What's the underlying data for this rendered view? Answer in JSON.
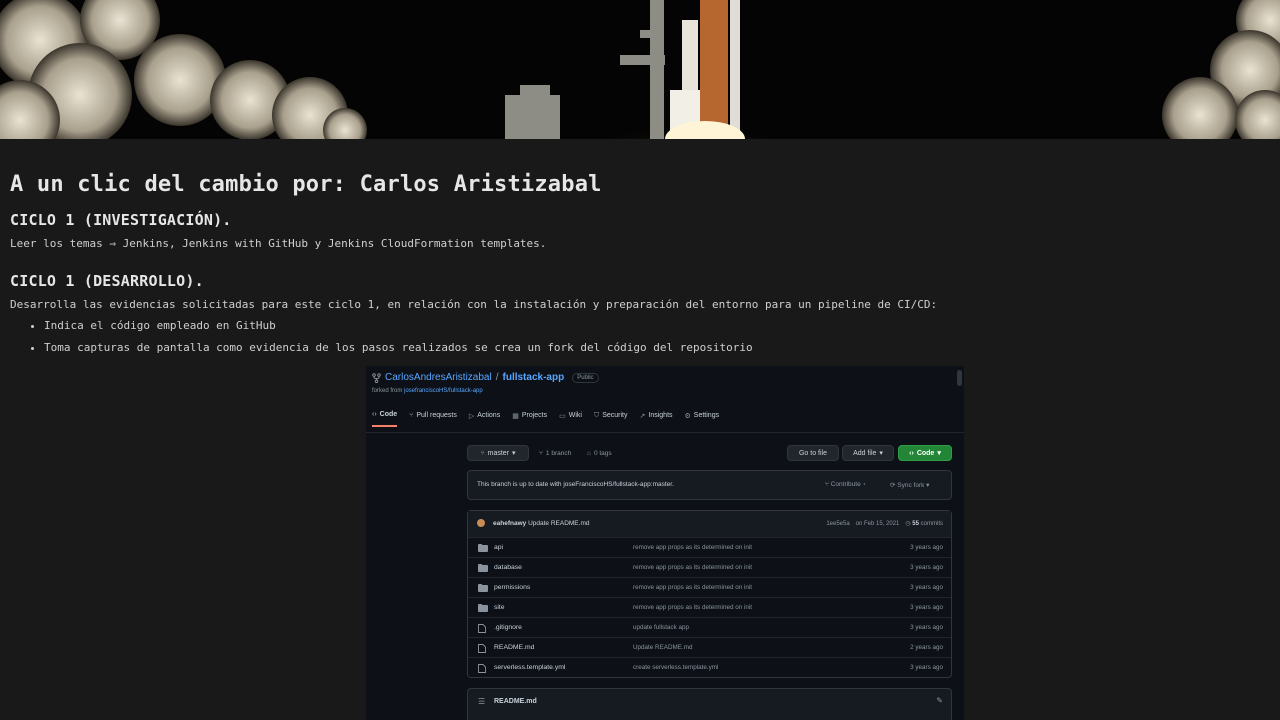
{
  "doc": {
    "title": "A un clic del cambio por: Carlos Aristizabal",
    "sections": [
      {
        "heading": "CICLO 1 (INVESTIGACIÓN).",
        "text": "Leer los temas ⇒ Jenkins, Jenkins with GitHub y Jenkins CloudFormation templates."
      },
      {
        "heading": "CICLO 1 (DESARROLLO).",
        "text": "Desarrolla las evidencias solicitadas para este ciclo 1, en relación con la instalación y preparación del entorno para un pipeline de CI/CD:",
        "bullets": [
          "Indica el código empleado en GitHub",
          "Toma capturas de pantalla como evidencia de los pasos realizados se crea un fork del código del repositorio"
        ]
      }
    ]
  },
  "github": {
    "owner": "CarlosAndresAristizabal",
    "separator": "/",
    "repo": "fullstack-app",
    "visibility": "Public",
    "forked_prefix": "forked from ",
    "forked_from": "josefranciscoHS/fullstack-app",
    "tabs": [
      "Code",
      "Pull requests",
      "Actions",
      "Projects",
      "Wiki",
      "Security",
      "Insights",
      "Settings"
    ],
    "branch_button": "master",
    "branches": "1 branch",
    "tags": "0 tags",
    "go_to_file": "Go to file",
    "add_file": "Add file",
    "code_button": "Code",
    "banner": "This branch is up to date with joseFranciscoHS/fullstack-app:master.",
    "contribute": "Contribute",
    "sync_fork": "Sync fork",
    "commit": {
      "author": "eahefnawy",
      "message": "Update README.md",
      "hash": "1ee5e5a",
      "date": "on Feb 15, 2021",
      "commits": "55",
      "commits_label": "commits"
    },
    "files": [
      {
        "type": "dir",
        "name": "api",
        "message": "remove app props as its determined on init",
        "age": "3 years ago"
      },
      {
        "type": "dir",
        "name": "database",
        "message": "remove app props as its determined on init",
        "age": "3 years ago"
      },
      {
        "type": "dir",
        "name": "permissions",
        "message": "remove app props as its determined on init",
        "age": "3 years ago"
      },
      {
        "type": "dir",
        "name": "site",
        "message": "remove app props as its determined on init",
        "age": "3 years ago"
      },
      {
        "type": "file",
        "name": ".gitignore",
        "message": "update fullstack app",
        "age": "3 years ago"
      },
      {
        "type": "file",
        "name": "README.md",
        "message": "Update README.md",
        "age": "2 years ago"
      },
      {
        "type": "file",
        "name": "serverless.template.yml",
        "message": "create serverless.template.yml",
        "age": "3 years ago"
      }
    ],
    "readme_title": "README.md"
  },
  "colors": {
    "page_bg": "#191919",
    "gh_bg": "#0d1117",
    "gh_link": "#58a6ff",
    "gh_green": "#238636",
    "tab_underline": "#f78166"
  }
}
